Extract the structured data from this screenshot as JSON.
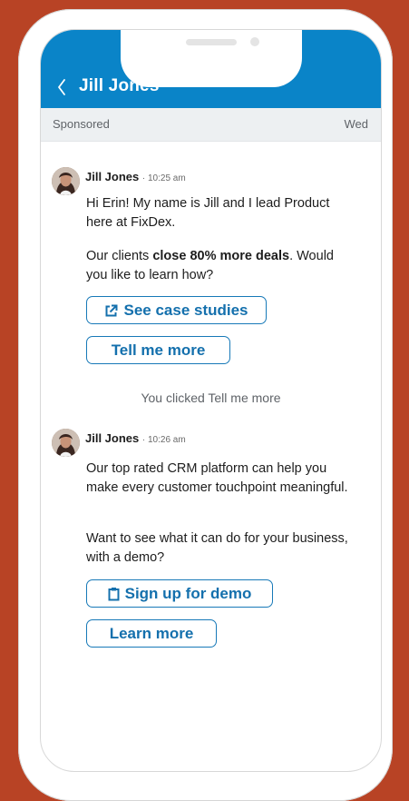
{
  "header": {
    "back_label": "‹",
    "title": "Jill Jones"
  },
  "subbar": {
    "left": "Sponsored",
    "right": "Wed"
  },
  "messages": [
    {
      "sender": "Jill Jones",
      "time": "10:25 am",
      "paragraph1": "Hi Erin! My name is Jill and I lead Product here at FixDex.",
      "paragraph2_before": "Our clients ",
      "paragraph2_bold": "close 80% more deals",
      "paragraph2_after": ". Would you like to learn how?",
      "buttons": [
        {
          "label": "See case studies",
          "icon": "external-link-icon"
        },
        {
          "label": "Tell me more",
          "icon": ""
        }
      ]
    },
    {
      "sender": "Jill Jones",
      "time": "10:26 am",
      "paragraph1": "Our top rated CRM platform can help you make every customer touchpoint meaningful.",
      "paragraph2": "Want to see what it can do for your business, with a demo?",
      "buttons": [
        {
          "label": "Sign up for demo",
          "icon": "clipboard-icon"
        },
        {
          "label": "Learn more",
          "icon": ""
        }
      ]
    }
  ],
  "system_note": "You clicked Tell me more",
  "colors": {
    "background": "#b84325",
    "header": "#0a84c8",
    "button_text": "#1470ad"
  }
}
